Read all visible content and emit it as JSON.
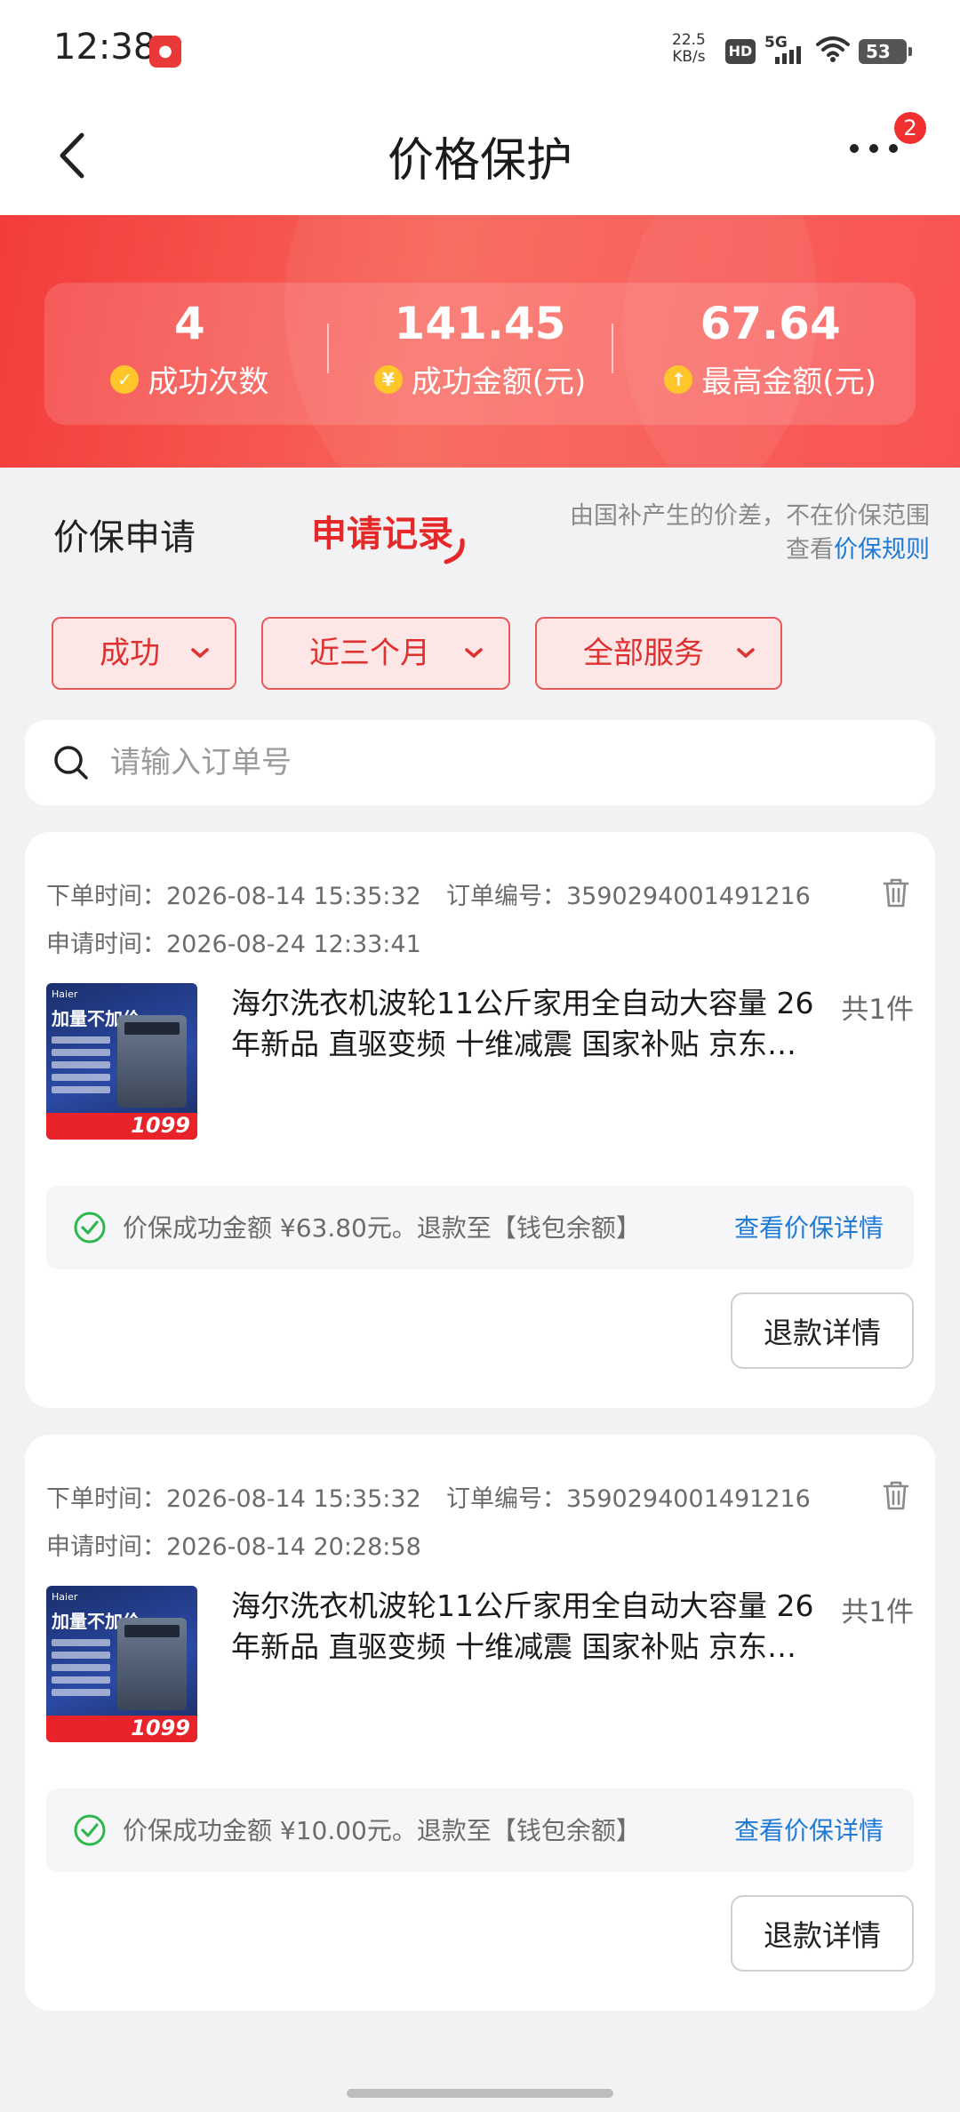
{
  "status_bar": {
    "time": "12:38",
    "speed_value": "22.5",
    "speed_unit": "KB/s",
    "hd": "HD",
    "network": "5G",
    "battery": "53"
  },
  "nav": {
    "title": "价格保护",
    "badge_count": "2"
  },
  "stats": [
    {
      "value": "4",
      "label": "成功次数",
      "icon": "check-icon"
    },
    {
      "value": "141.45",
      "label": "成功金额(元)",
      "icon": "yen-icon"
    },
    {
      "value": "67.64",
      "label": "最高金额(元)",
      "icon": "arrow-up-icon"
    }
  ],
  "tabs": {
    "apply": "价保申请",
    "records": "申请记录",
    "note_line1": "由国补产生的价差，不在价保范围",
    "note_prefix": "查看",
    "rule_link": "价保规则"
  },
  "filters": [
    {
      "label": "成功"
    },
    {
      "label": "近三个月"
    },
    {
      "label": "全部服务"
    }
  ],
  "search": {
    "placeholder": "请输入订单号"
  },
  "orders": [
    {
      "order_time": "下单时间：2026-08-14 15:35:32",
      "order_no": "订单编号：3590294001491216",
      "apply_time": "申请时间：2026-08-24 12:33:41",
      "product_title": "海尔洗衣机波轮11公斤家用全自动大容量 26年新品 直驱变频 十维减震 国家补贴 京东…",
      "qty": "共1件",
      "result": "价保成功金额 ¥63.80元。退款至【钱包余额】",
      "detail_link": "查看价保详情",
      "refund_button": "退款详情",
      "thumb_brand": "Haier",
      "thumb_headline": "加量不加价",
      "thumb_price": "1099"
    },
    {
      "order_time": "下单时间：2026-08-14 15:35:32",
      "order_no": "订单编号：3590294001491216",
      "apply_time": "申请时间：2026-08-14 20:28:58",
      "product_title": "海尔洗衣机波轮11公斤家用全自动大容量 26年新品 直驱变频 十维减震 国家补贴 京东…",
      "qty": "共1件",
      "result": "价保成功金额 ¥10.00元。退款至【钱包余额】",
      "detail_link": "查看价保详情",
      "refund_button": "退款详情",
      "thumb_brand": "Haier",
      "thumb_headline": "加量不加价",
      "thumb_price": "1099"
    }
  ],
  "colors": {
    "accent_red": "#e62828",
    "link_blue": "#1f7ad6",
    "success_green": "#2db84d",
    "stat_icon_yellow": "#ffc629"
  }
}
